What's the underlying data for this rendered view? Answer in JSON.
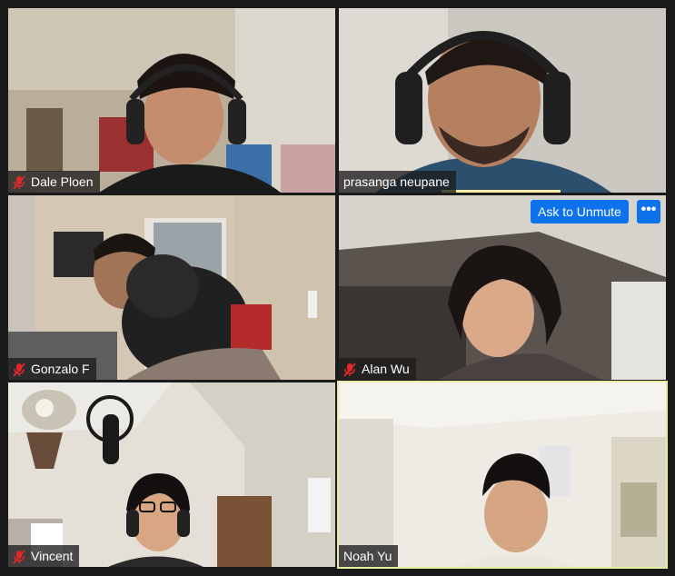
{
  "meeting": {
    "participants": [
      {
        "name": "Dale Ploen",
        "muted": true,
        "active_speaker": false
      },
      {
        "name": "prasanga neupane",
        "muted": false,
        "active_speaker": false,
        "speaking": true
      },
      {
        "name": "Gonzalo F",
        "muted": true,
        "active_speaker": false
      },
      {
        "name": "Alan Wu",
        "muted": true,
        "active_speaker": false
      },
      {
        "name": "Vincent",
        "muted": true,
        "active_speaker": false
      },
      {
        "name": "Noah Yu",
        "muted": false,
        "active_speaker": true
      }
    ],
    "tile_actions": {
      "ask_to_unmute_label": "Ask to Unmute",
      "more_label": "•••"
    }
  },
  "colors": {
    "background": "#1a1a1a",
    "active_speaker_border": "#e7eda0",
    "button_blue": "#0e72ed",
    "muted_red": "#e02828"
  },
  "icons": {
    "muted": "muted-microphone-icon",
    "more": "more-options-icon"
  }
}
